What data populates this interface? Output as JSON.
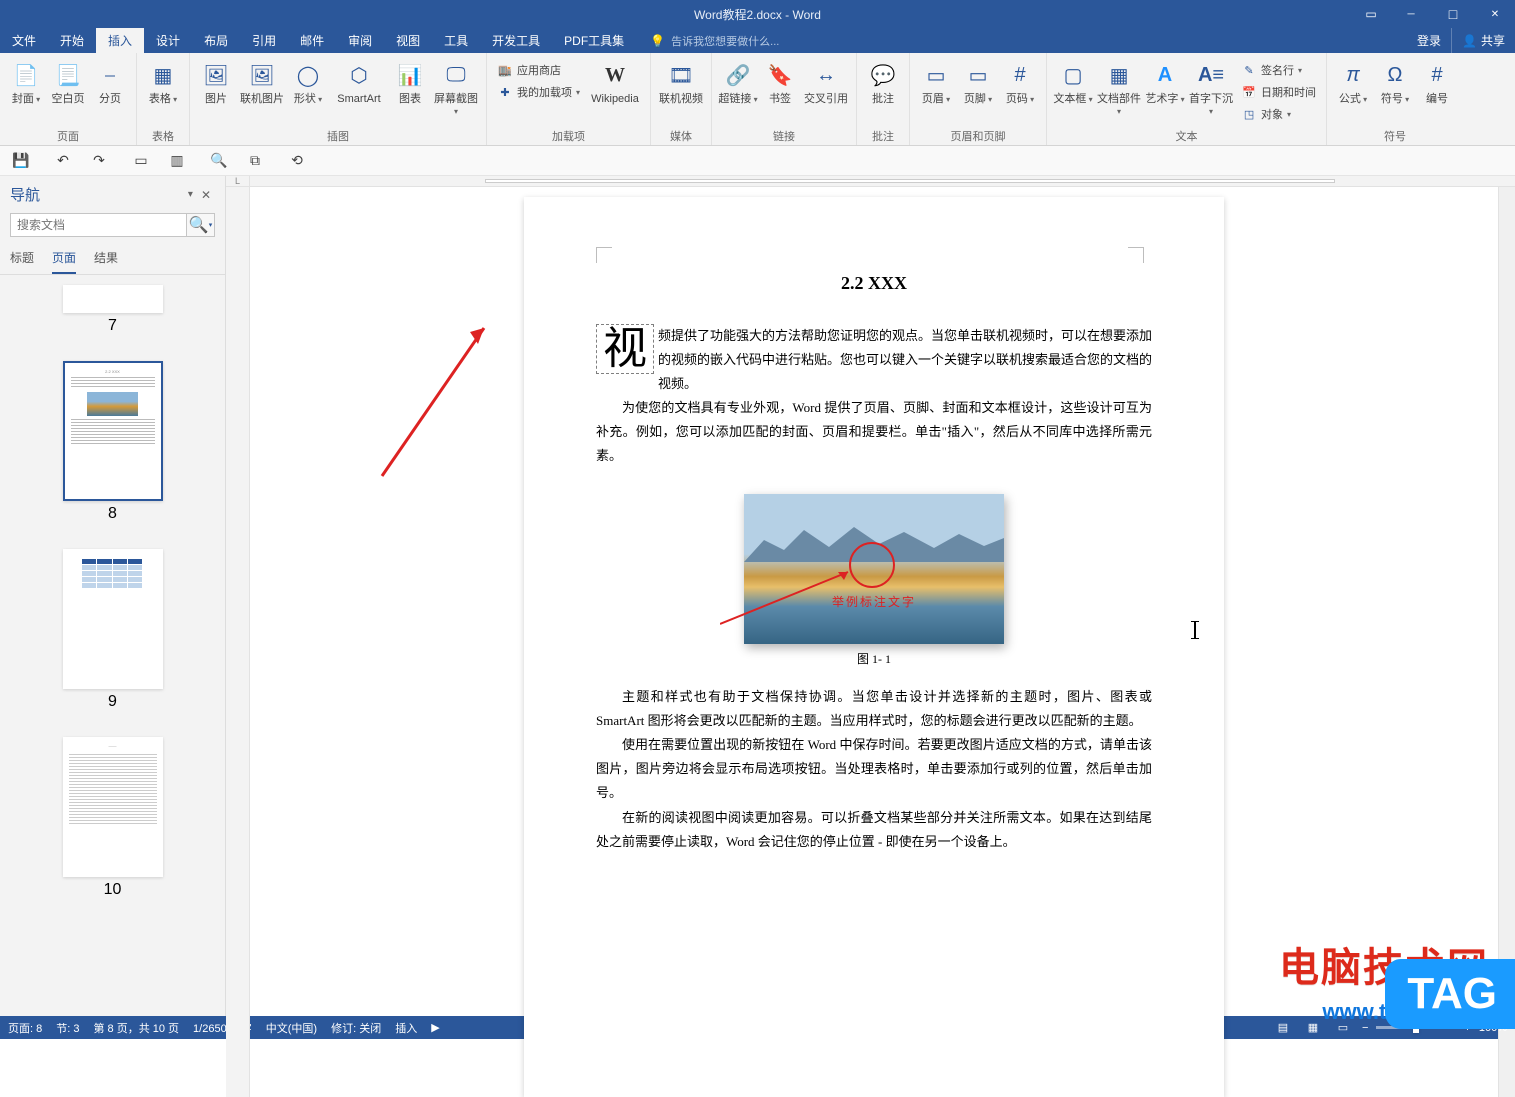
{
  "title": "Word教程2.docx - Word",
  "tabs": {
    "file": "文件",
    "home": "开始",
    "insert": "插入",
    "design": "设计",
    "layout": "布局",
    "references": "引用",
    "mailings": "邮件",
    "review": "审阅",
    "view": "视图",
    "tools": "工具",
    "developer": "开发工具",
    "pdf": "PDF工具集",
    "tell_placeholder": "告诉我您想要做什么...",
    "signin": "登录",
    "share": "共享"
  },
  "ribbon": {
    "pages": {
      "cover": "封面",
      "blank": "空白页",
      "break": "分页",
      "label": "页面"
    },
    "tables": {
      "table": "表格",
      "label": "表格"
    },
    "illus": {
      "pic": "图片",
      "online_pic": "联机图片",
      "shapes": "形状",
      "smartart": "SmartArt",
      "chart": "图表",
      "screenshot": "屏幕截图",
      "label": "插图"
    },
    "addins": {
      "store": "应用商店",
      "my": "我的加载项",
      "wikipedia": "Wikipedia",
      "label": "加载项"
    },
    "media": {
      "video": "联机视频",
      "label": "媒体"
    },
    "links": {
      "hyperlink": "超链接",
      "bookmark": "书签",
      "crossref": "交叉引用",
      "label": "链接"
    },
    "comments": {
      "comment": "批注",
      "label": "批注"
    },
    "headerfooter": {
      "header": "页眉",
      "footer": "页脚",
      "pagenum": "页码",
      "label": "页眉和页脚"
    },
    "text": {
      "textbox": "文本框",
      "quickparts": "文档部件",
      "wordart": "艺术字",
      "dropcap": "首字下沉",
      "sigline": "签名行",
      "datetime": "日期和时间",
      "object": "对象",
      "label": "文本"
    },
    "symbols": {
      "equation": "公式",
      "symbol": "符号",
      "number": "编号",
      "label": "符号"
    }
  },
  "nav": {
    "title": "导航",
    "search_placeholder": "搜索文档",
    "tabs": {
      "headings": "标题",
      "pages": "页面",
      "results": "结果"
    },
    "page7": "7",
    "page8": "8",
    "page9": "9",
    "page10": "10"
  },
  "doc": {
    "heading": "2.2 XXX",
    "dropcap_char": "视",
    "p1": "频提供了功能强大的方法帮助您证明您的观点。当您单击联机视频时，可以在想要添加的视频的嵌入代码中进行粘贴。您也可以键入一个关键字以联机搜索最适合您的文档的视频。",
    "p2": "为使您的文档具有专业外观，Word 提供了页眉、页脚、封面和文本框设计，这些设计可互为补充。例如，您可以添加匹配的封面、页眉和提要栏。单击\"插入\"，然后从不同库中选择所需元素。",
    "fig_caption": "图 1- 1",
    "fig_annotation": "举例标注文字",
    "p3": "主题和样式也有助于文档保持协调。当您单击设计并选择新的主题时，图片、图表或 SmartArt 图形将会更改以匹配新的主题。当应用样式时，您的标题会进行更改以匹配新的主题。",
    "p4": "使用在需要位置出现的新按钮在 Word 中保存时间。若要更改图片适应文档的方式，请单击该图片，图片旁边将会显示布局选项按钮。当处理表格时，单击要添加行或列的位置，然后单击加号。",
    "p5": "在新的阅读视图中阅读更加容易。可以折叠文档某些部分并关注所需文本。如果在达到结尾处之前需要停止读取，Word 会记住您的停止位置 - 即使在另一个设备上。"
  },
  "status": {
    "page": "页面: 8",
    "section": "节: 3",
    "pageof": "第 8 页，共 10 页",
    "words": "1/2650 个字",
    "lang": "中文(中国)",
    "track": "修订: 关闭",
    "mode": "插入",
    "zoom": "100%"
  },
  "watermark": {
    "site": "电脑技术网",
    "url": "www.tagxp.com",
    "tag": "TAG"
  }
}
